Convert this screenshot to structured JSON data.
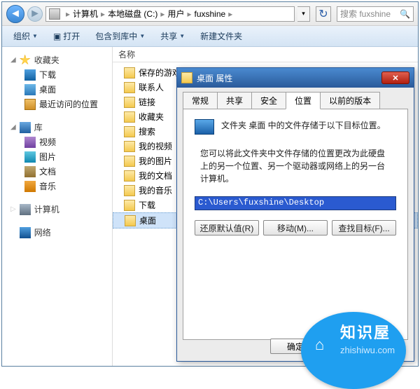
{
  "nav": {
    "crumbs": [
      "计算机",
      "本地磁盘 (C:)",
      "用户",
      "fuxshine"
    ],
    "search_placeholder": "搜索 fuxshine"
  },
  "cmdbar": {
    "organize": "组织",
    "open": "打开",
    "include": "包含到库中",
    "share": "共享",
    "newfolder": "新建文件夹"
  },
  "sidebar": {
    "favorites": {
      "label": "收藏夹",
      "items": [
        "下载",
        "桌面",
        "最近访问的位置"
      ]
    },
    "libraries": {
      "label": "库",
      "items": [
        "视频",
        "图片",
        "文档",
        "音乐"
      ]
    },
    "computer": "计算机",
    "network": "网络"
  },
  "content": {
    "col_name": "名称",
    "items": [
      "保存的游戏",
      "联系人",
      "链接",
      "收藏夹",
      "搜索",
      "我的视频",
      "我的图片",
      "我的文档",
      "我的音乐",
      "下载",
      "桌面"
    ]
  },
  "dialog": {
    "title": "桌面 属性",
    "tabs": [
      "常规",
      "共享",
      "安全",
      "位置",
      "以前的版本"
    ],
    "active_tab": 3,
    "line1": "文件夹 桌面 中的文件存储于以下目标位置。",
    "line2": "您可以将此文件夹中文件存储的位置更改为此硬盘上的另一个位置、另一个驱动器或网络上的另一台计算机。",
    "path": "C:\\Users\\fuxshine\\Desktop",
    "btn_restore": "还原默认值(R)",
    "btn_move": "移动(M)...",
    "btn_find": "查找目标(F)...",
    "btn_ok": "确定"
  },
  "badge": {
    "title": "知识屋",
    "url": "zhishiwu.com"
  }
}
